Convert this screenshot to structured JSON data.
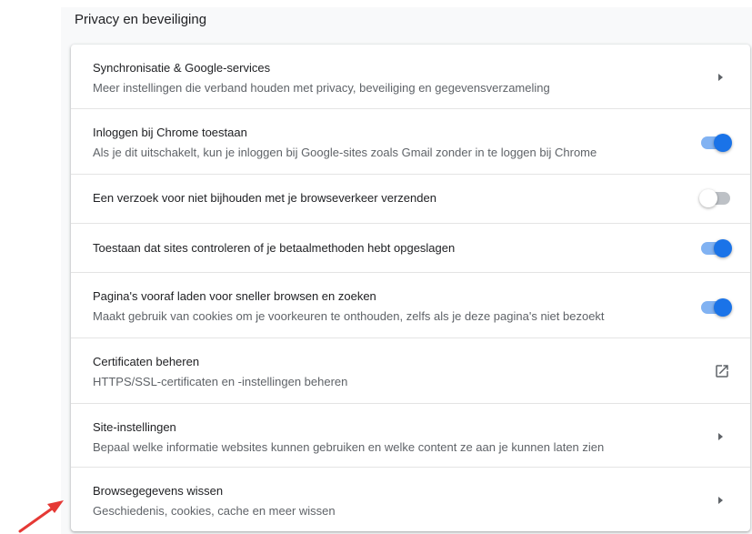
{
  "section": {
    "title": "Privacy en beveiliging"
  },
  "rows": [
    {
      "primary": "Synchronisatie & Google-services",
      "secondary": "Meer instellingen die verband houden met privacy, beveiliging en gegevensverzameling",
      "control": "arrow"
    },
    {
      "primary": "Inloggen bij Chrome toestaan",
      "secondary": "Als je dit uitschakelt, kun je inloggen bij Google-sites zoals Gmail zonder in te loggen bij Chrome",
      "control": "toggle",
      "checked": true
    },
    {
      "primary": "Een verzoek voor niet bijhouden met je browseverkeer verzenden",
      "control": "toggle",
      "checked": false
    },
    {
      "primary": "Toestaan dat sites controleren of je betaalmethoden hebt opgeslagen",
      "control": "toggle",
      "checked": true
    },
    {
      "primary": "Pagina's vooraf laden voor sneller browsen en zoeken",
      "secondary": "Maakt gebruik van cookies om je voorkeuren te onthouden, zelfs als je deze pagina's niet bezoekt",
      "control": "toggle",
      "checked": true
    },
    {
      "primary": "Certificaten beheren",
      "secondary": "HTTPS/SSL-certificaten en -instellingen beheren",
      "control": "external",
      "icon": "open-in-new-icon"
    },
    {
      "primary": "Site-instellingen",
      "secondary": "Bepaal welke informatie websites kunnen gebruiken en welke content ze aan je kunnen laten zien",
      "control": "arrow"
    },
    {
      "primary": "Browsegegevens wissen",
      "secondary": "Geschiedenis, cookies, cache en meer wissen",
      "control": "arrow"
    }
  ],
  "colors": {
    "accent": "#1a73e8",
    "annotation_arrow": "#e53935"
  },
  "annotation": {
    "icon": "red-pointer-arrow-icon"
  }
}
